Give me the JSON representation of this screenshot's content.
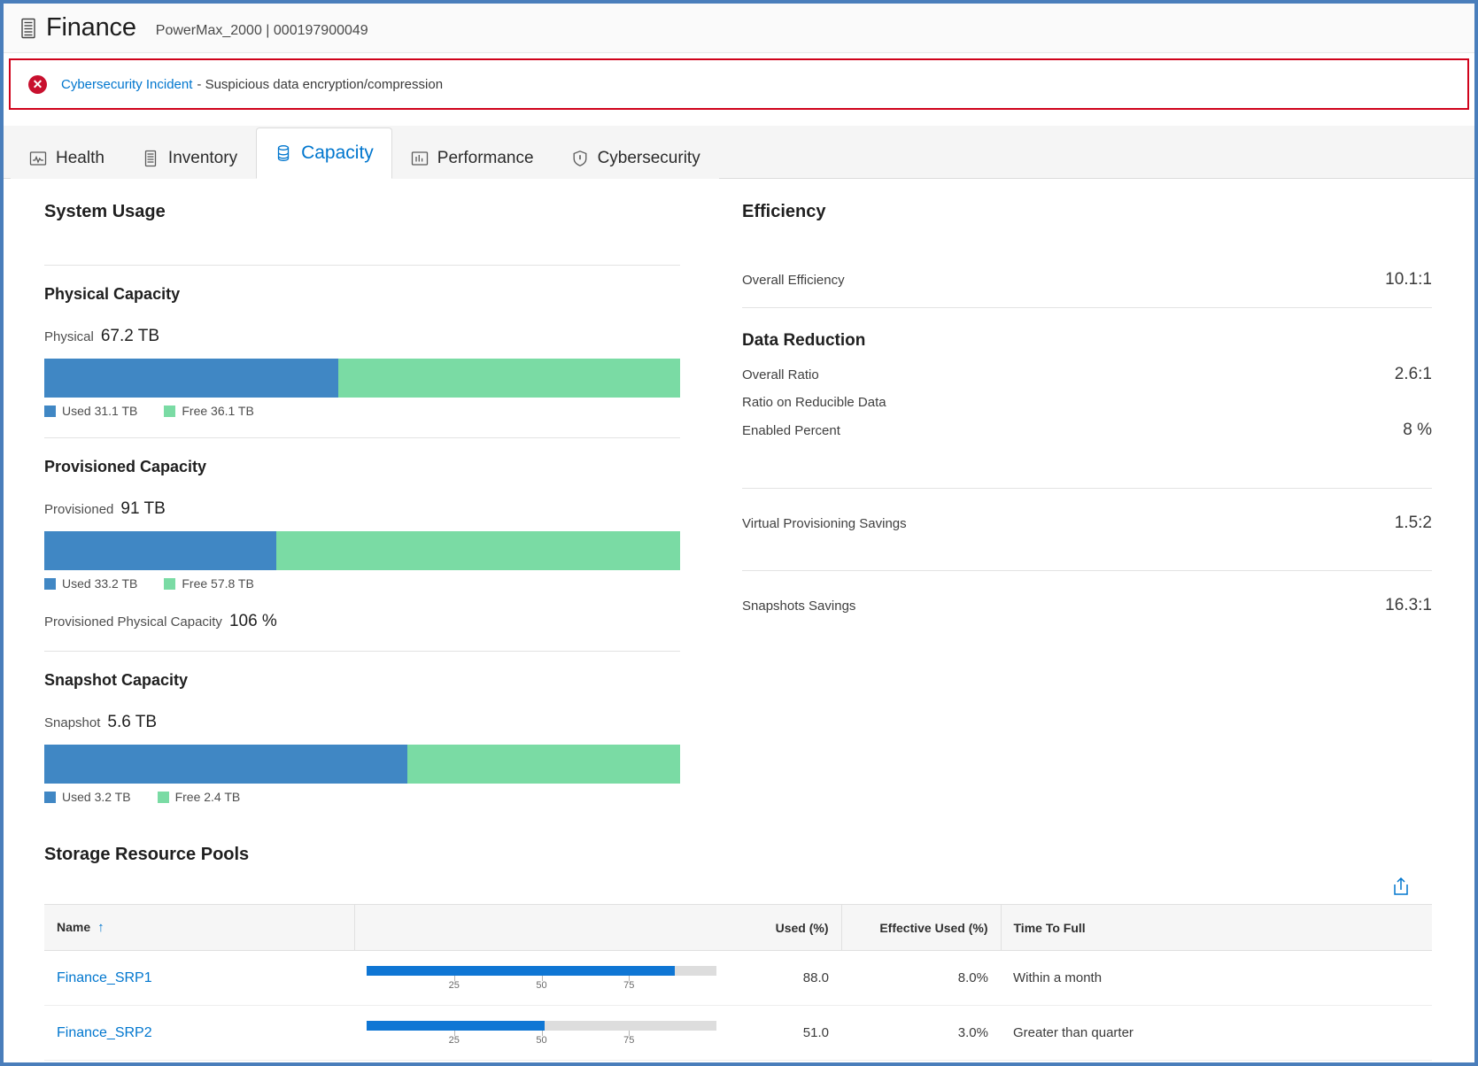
{
  "header": {
    "icon": "storage-array-icon",
    "title": "Finance",
    "subtitle": "PowerMax_2000 | 000197900049"
  },
  "alert": {
    "icon": "error-circle-icon",
    "link_label": "Cybersecurity Incident",
    "message": "- Suspicious data encryption/compression"
  },
  "tabs": [
    {
      "label": "Health",
      "icon": "health-pulse-icon",
      "active": false
    },
    {
      "label": "Inventory",
      "icon": "inventory-icon",
      "active": false
    },
    {
      "label": "Capacity",
      "icon": "capacity-disk-icon",
      "active": true
    },
    {
      "label": "Performance",
      "icon": "bar-chart-icon",
      "active": false
    },
    {
      "label": "Cybersecurity",
      "icon": "shield-icon",
      "active": false
    }
  ],
  "system_usage": {
    "title": "System Usage",
    "blocks": [
      {
        "title": "Physical Capacity",
        "total_label": "Physical",
        "total_value": "67.2 TB",
        "used_label": "Used 31.1 TB",
        "free_label": "Free 36.1 TB",
        "used_pct": 46.3
      },
      {
        "title": "Provisioned Capacity",
        "total_label": "Provisioned",
        "total_value": "91 TB",
        "used_label": "Used 33.2 TB",
        "free_label": "Free 57.8 TB",
        "used_pct": 36.5,
        "extra_label": "Provisioned Physical Capacity",
        "extra_value": "106 %"
      },
      {
        "title": "Snapshot Capacity",
        "total_label": "Snapshot",
        "total_value": "5.6 TB",
        "used_label": "Used 3.2 TB",
        "free_label": "Free 2.4 TB",
        "used_pct": 57.1
      }
    ]
  },
  "efficiency": {
    "title": "Efficiency",
    "overall_efficiency_label": "Overall Efficiency",
    "overall_efficiency_value": "10.1:1",
    "data_reduction_title": "Data Reduction",
    "overall_ratio_label": "Overall Ratio",
    "overall_ratio_value": "2.6:1",
    "reducible_label": "Ratio on Reducible Data",
    "enabled_percent_label": "Enabled Percent",
    "enabled_percent_value": "8 %",
    "virtual_prov_label": "Virtual Provisioning Savings",
    "virtual_prov_value": "1.5:2",
    "snapshots_label": "Snapshots Savings",
    "snapshots_value": "16.3:1"
  },
  "storage_resource_pools": {
    "title": "Storage Resource Pools",
    "export_icon": "export-icon",
    "columns": {
      "name": "Name",
      "sort_arrow": "↑",
      "bar": "",
      "used": "Used (%)",
      "effective_used": "Effective Used (%)",
      "time_to_full": "Time To Full"
    },
    "gauge_ticks": [
      "25",
      "50",
      "75"
    ],
    "rows": [
      {
        "name": "Finance_SRP1",
        "used_pct": 88.0,
        "used": "88.0",
        "effective_used": "8.0%",
        "time_to_full": "Within a month"
      },
      {
        "name": "Finance_SRP2",
        "used_pct": 51.0,
        "used": "51.0",
        "effective_used": "3.0%",
        "time_to_full": "Greater than quarter"
      }
    ]
  },
  "colors": {
    "accent": "#0076ce",
    "used_bar": "#4087c4",
    "free_bar": "#7adba4",
    "alert_border": "#d0021b",
    "gauge_fill": "#0f76d4"
  }
}
